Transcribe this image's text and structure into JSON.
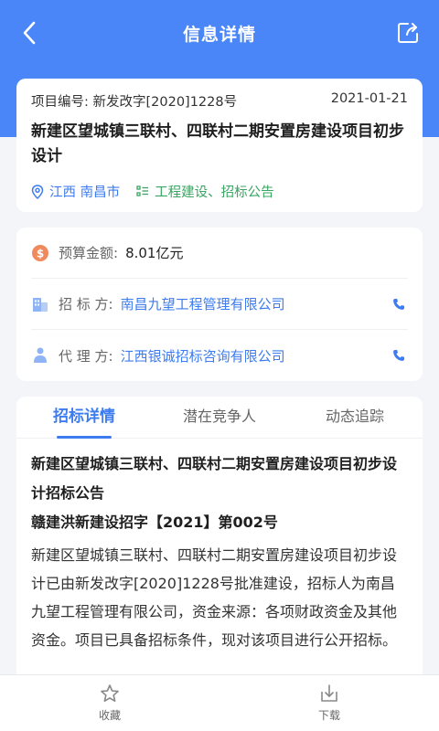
{
  "header": {
    "title": "信息详情"
  },
  "project": {
    "number_label": "项目编号: 新发改字[2020]1228号",
    "date": "2021-01-21",
    "title": "新建区望城镇三联村、四联村二期安置房建设项目初步设计",
    "location": "江西 南昌市",
    "category": "工程建设、招标公告"
  },
  "info": {
    "budget_label": "预算金额:",
    "budget_value": "8.01亿元",
    "tenderer_label": "招 标 方:",
    "tenderer_value": "南昌九望工程管理有限公司",
    "agent_label": "代 理 方:",
    "agent_value": "江西银诚招标咨询有限公司"
  },
  "tabs": [
    {
      "label": "招标详情",
      "active": true
    },
    {
      "label": "潜在竞争人",
      "active": false
    },
    {
      "label": "动态追踪",
      "active": false
    }
  ],
  "detail": {
    "heading": "新建区望城镇三联村、四联村二期安置房建设项目初步设计招标公告",
    "doc_number": "赣建洪新建设招字【2021】第002号",
    "body": "新建区望城镇三联村、四联村二期安置房建设项目初步设计已由新发改字[2020]1228号批准建设，招标人为南昌九望工程管理有限公司，资金来源：各项财政资金及其他资金。项目已具备招标条件，现对该项目进行公开招标。"
  },
  "bottom_bar": {
    "favorite_label": "收藏",
    "download_label": "下载"
  },
  "colors": {
    "header_blue": "#4a86f7",
    "link_blue": "#3d7cf0",
    "category_green": "#3aa562",
    "budget_orange": "#f08a5d"
  }
}
